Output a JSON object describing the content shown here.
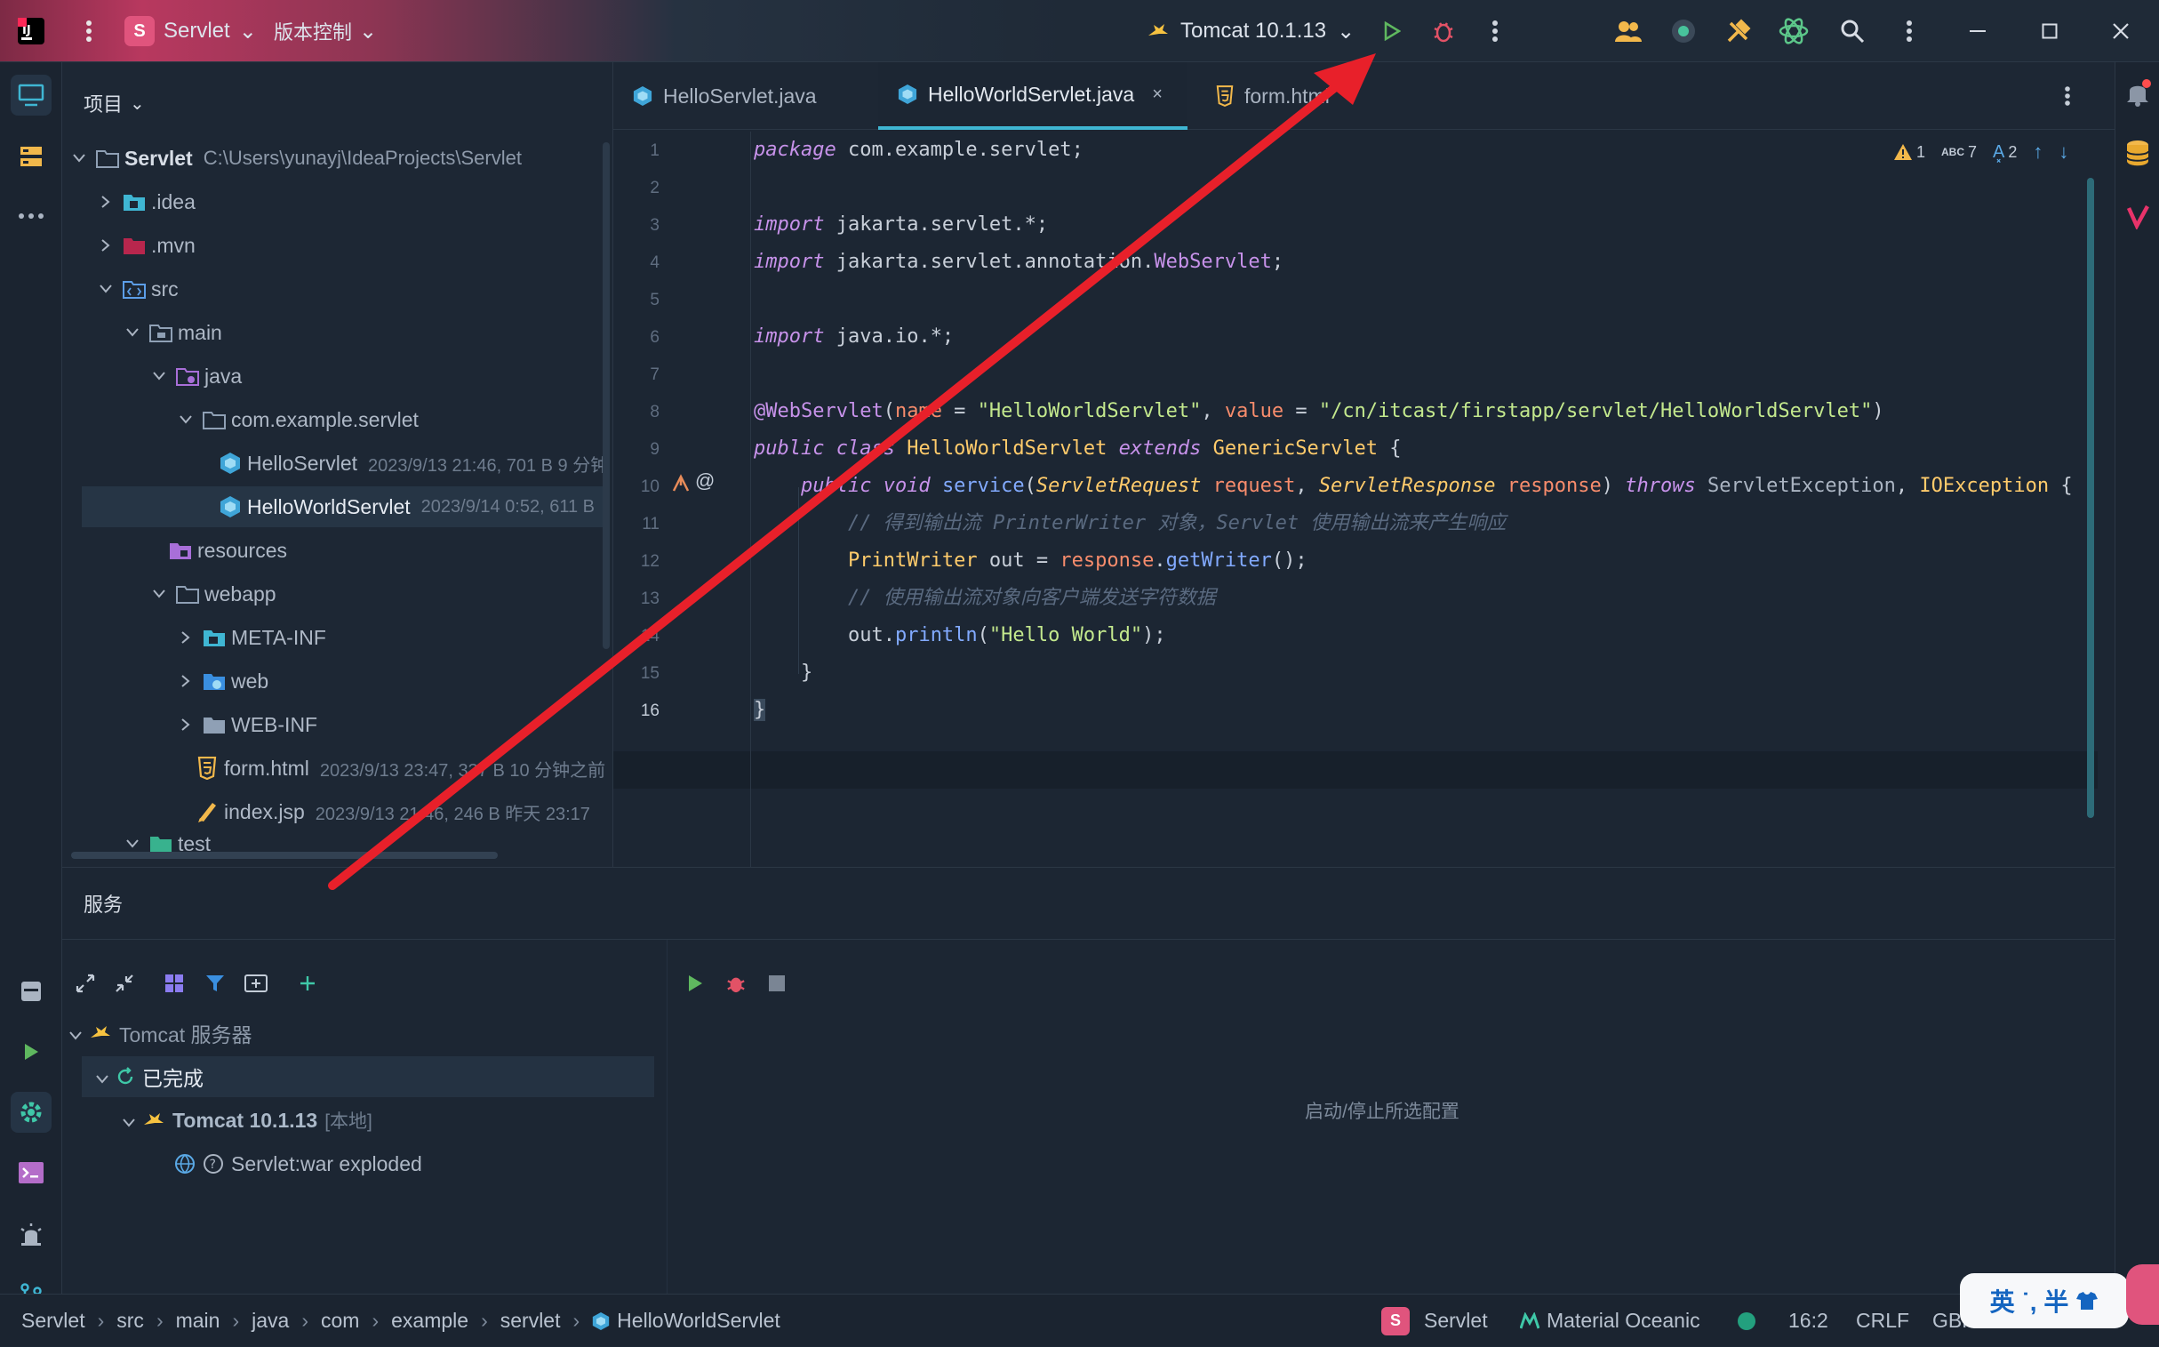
{
  "titlebar": {
    "project_badge": "S",
    "project_name": "Servlet",
    "vcs_label": "版本控制",
    "run_config": "Tomcat 10.1.13"
  },
  "project_panel": {
    "header": "项目",
    "tree": [
      {
        "label": "Servlet",
        "meta": "C:\\Users\\yunayj\\IdeaProjects\\Servlet",
        "icon": "folder-icon"
      },
      {
        "label": ".idea",
        "meta": "",
        "icon": "idea-folder-icon"
      },
      {
        "label": ".mvn",
        "meta": "",
        "icon": "mvn-folder-icon"
      },
      {
        "label": "src",
        "meta": "",
        "icon": "src-folder-icon"
      },
      {
        "label": "main",
        "meta": "",
        "icon": "folder-icon"
      },
      {
        "label": "java",
        "meta": "",
        "icon": "java-folder-icon"
      },
      {
        "label": "com.example.servlet",
        "meta": "",
        "icon": "package-icon"
      },
      {
        "label": "HelloServlet",
        "meta": "2023/9/13 21:46, 701 B 9 分钟",
        "icon": "java-class-icon"
      },
      {
        "label": "HelloWorldServlet",
        "meta": "2023/9/14 0:52, 611 B",
        "icon": "java-class-icon"
      },
      {
        "label": "resources",
        "meta": "",
        "icon": "resources-folder-icon"
      },
      {
        "label": "webapp",
        "meta": "",
        "icon": "folder-icon"
      },
      {
        "label": "META-INF",
        "meta": "",
        "icon": "meta-folder-icon"
      },
      {
        "label": "web",
        "meta": "",
        "icon": "web-folder-icon"
      },
      {
        "label": "WEB-INF",
        "meta": "",
        "icon": "folder-icon"
      },
      {
        "label": "form.html",
        "meta": "2023/9/13 23:47, 337 B 10 分钟之前",
        "icon": "html-file-icon"
      },
      {
        "label": "index.jsp",
        "meta": "2023/9/13 21:46, 246 B 昨天 23:17",
        "icon": "jsp-file-icon"
      },
      {
        "label": "test",
        "meta": "",
        "icon": "test-folder-icon"
      }
    ]
  },
  "editor": {
    "tabs": [
      {
        "label": "HelloServlet.java"
      },
      {
        "label": "HelloWorldServlet.java"
      },
      {
        "label": "form.html"
      }
    ],
    "inspections": {
      "warnings": "1",
      "typos": "7",
      "grammar": "2"
    },
    "line_numbers": [
      "1",
      "2",
      "3",
      "4",
      "5",
      "6",
      "7",
      "8",
      "9",
      "10",
      "11",
      "12",
      "13",
      "14",
      "15",
      "16"
    ],
    "lines": [
      "package com.example.servlet;",
      "",
      "import jakarta.servlet.*;",
      "import jakarta.servlet.annotation.WebServlet;",
      "",
      "import java.io.*;",
      "",
      "@WebServlet(name = \"HelloWorldServlet\", value = \"/cn/itcast/firstapp/servlet/HelloWorldServlet\")",
      "public class HelloWorldServlet extends GenericServlet {",
      "    public void service(ServletRequest request, ServletResponse response) throws ServletException, IOException {",
      "        // 得到输出流 PrinterWriter 对象，Servlet 使用输出流来产生响应",
      "        PrintWriter out = response.getWriter();",
      "        // 使用输出流对象向客户端发送字符数据",
      "        out.println(\"Hello World\");",
      "    }",
      "}"
    ]
  },
  "services": {
    "title": "服务",
    "tree": {
      "root": "Tomcat 服务器",
      "group": "已完成",
      "server": "Tomcat 10.1.13",
      "server_suffix": "[本地]",
      "artifact": "Servlet:war exploded"
    },
    "empty_hint": "启动/停止所选配置"
  },
  "statusbar": {
    "breadcrumbs": [
      "Servlet",
      "src",
      "main",
      "java",
      "com",
      "example",
      "servlet",
      "HelloWorldServlet"
    ],
    "project": "Servlet",
    "theme": "Material Oceanic",
    "position": "16:2",
    "line_sep": "CRLF",
    "encoding": "GBK"
  },
  "ime": {
    "label": "英 ˙, 半"
  },
  "colors": {
    "accent": "#3fb6d3",
    "arrow": "#e8202a",
    "titlebar": "#b8385f"
  }
}
